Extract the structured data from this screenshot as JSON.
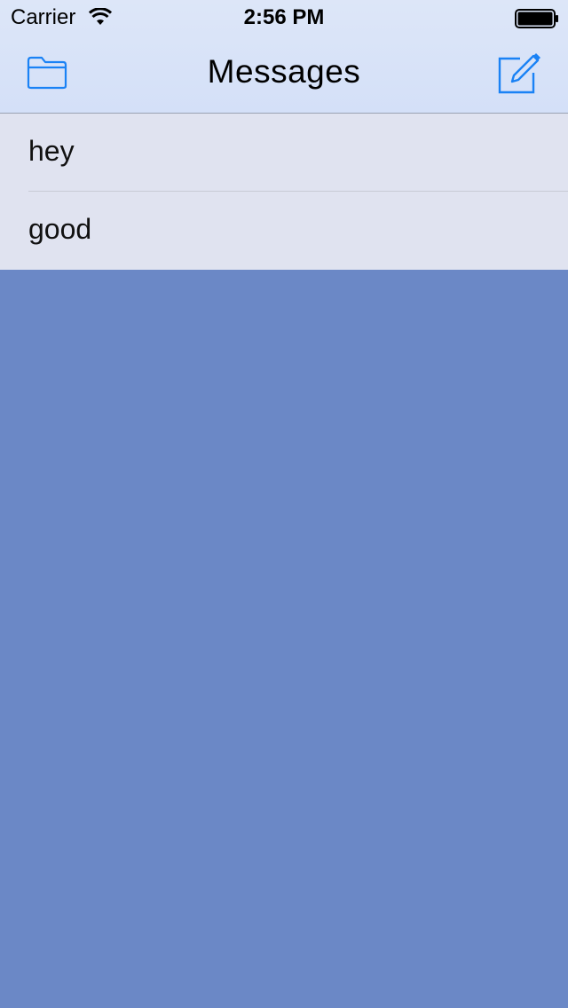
{
  "status_bar": {
    "carrier": "Carrier",
    "time": "2:56 PM",
    "wifi_icon": "wifi-icon",
    "battery_icon": "battery-icon"
  },
  "nav": {
    "title": "Messages",
    "left_icon": "folder-icon",
    "right_icon": "compose-icon",
    "accent_color": "#1a82f5"
  },
  "messages": [
    {
      "label": "hey"
    },
    {
      "label": "good"
    }
  ],
  "colors": {
    "background": "#6b88c6",
    "list_background": "#e0e3f0",
    "nav_background": "#d6e1f8"
  }
}
